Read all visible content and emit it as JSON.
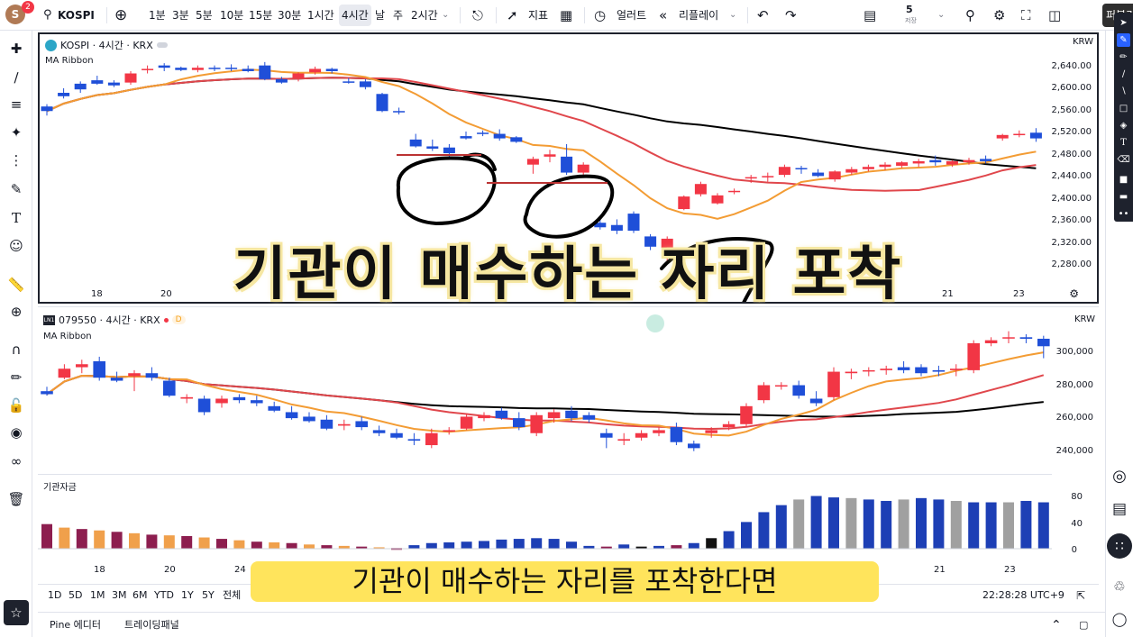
{
  "top_toolbar": {
    "avatar_initial": "S",
    "notification_count": "2",
    "symbol": "KOSPI",
    "intervals": [
      "1분",
      "3분",
      "5분",
      "10분",
      "15분",
      "30분",
      "1시간",
      "4시간",
      "날",
      "주",
      "2시간"
    ],
    "active_interval": "4시간",
    "indicators_label": "지표",
    "alert_label": "얼러트",
    "replay_label": "리플레이",
    "layout_number": "5",
    "layout_sub": "저장",
    "publish_label": "퍼블리"
  },
  "chart1": {
    "legend_title": "KOSPI · 4시간 · KRX",
    "indicator": "MA Ribbon",
    "currency": "KRW",
    "price_labels": [
      "2,640.00",
      "2,600.00",
      "2,560.00",
      "2,520.00",
      "2,480.00",
      "2,440.00",
      "2,400.00",
      "2,360.00",
      "2,320.00",
      "2,280.00"
    ],
    "date_labels": [
      "18",
      "20",
      "21",
      "23"
    ]
  },
  "chart2": {
    "legend_title": "079550 · 4시간 · KRX",
    "legend_badge": "D",
    "indicator": "MA Ribbon",
    "currency": "KRW",
    "price_labels": [
      "300,000",
      "280,000",
      "260,000",
      "240,000"
    ],
    "sub_indicator": "기관자금",
    "sub_labels": [
      "80",
      "40",
      "0"
    ],
    "date_labels": [
      "18",
      "20",
      "24",
      "21",
      "23"
    ]
  },
  "bottom_bar": {
    "ranges": [
      "1D",
      "5D",
      "1M",
      "3M",
      "6M",
      "YTD",
      "1Y",
      "5Y",
      "전체"
    ],
    "clock": "22:28:28 UTC+9"
  },
  "footer": {
    "tabs": [
      "Pine 에디터",
      "트레이딩패널"
    ]
  },
  "captions": {
    "headline": "기관이 매수하는 자리 포착",
    "subtitle": "기관이 매수하는 자리를 포착한다면"
  },
  "colors": {
    "up": "#f23645",
    "down": "#1f4fd8",
    "ma_fast": "#f39c34",
    "ma_mid": "#e0474c",
    "ma_slow": "#000000",
    "caption_bg": "#ffe45c"
  },
  "chart_data": [
    {
      "type": "candlestick",
      "title": "KOSPI · 4시간 · KRX",
      "indicator": "MA Ribbon",
      "ylim": [
        2260,
        2660
      ],
      "candles": [
        [
          2568,
          2572,
          2552,
          2560
        ],
        [
          2592,
          2600,
          2582,
          2586
        ],
        [
          2608,
          2612,
          2592,
          2598
        ],
        [
          2614,
          2622,
          2606,
          2608
        ],
        [
          2610,
          2614,
          2602,
          2605
        ],
        [
          2610,
          2630,
          2606,
          2626
        ],
        [
          2632,
          2640,
          2626,
          2634
        ],
        [
          2640,
          2644,
          2630,
          2636
        ],
        [
          2636,
          2638,
          2630,
          2632
        ],
        [
          2632,
          2640,
          2628,
          2636
        ],
        [
          2636,
          2640,
          2630,
          2634
        ],
        [
          2636,
          2642,
          2630,
          2634
        ],
        [
          2634,
          2640,
          2628,
          2630
        ],
        [
          2640,
          2646,
          2614,
          2616
        ],
        [
          2616,
          2620,
          2608,
          2610
        ],
        [
          2618,
          2628,
          2612,
          2626
        ],
        [
          2628,
          2638,
          2624,
          2634
        ],
        [
          2634,
          2636,
          2626,
          2630
        ],
        [
          2612,
          2618,
          2608,
          2610
        ],
        [
          2612,
          2616,
          2598,
          2602
        ],
        [
          2590,
          2592,
          2558,
          2560
        ],
        [
          2560,
          2566,
          2554,
          2558
        ],
        [
          2510,
          2520,
          2496,
          2498
        ],
        [
          2498,
          2510,
          2490,
          2494
        ],
        [
          2496,
          2502,
          2480,
          2486
        ],
        [
          2516,
          2524,
          2510,
          2512
        ],
        [
          2522,
          2526,
          2516,
          2520
        ],
        [
          2520,
          2528,
          2508,
          2512
        ],
        [
          2514,
          2516,
          2504,
          2506
        ],
        [
          2466,
          2480,
          2450,
          2476
        ],
        [
          2480,
          2492,
          2470,
          2484
        ],
        [
          2480,
          2502,
          2448,
          2452
        ],
        [
          2452,
          2470,
          2448,
          2466
        ],
        [
          2364,
          2376,
          2352,
          2356
        ],
        [
          2360,
          2370,
          2344,
          2350
        ],
        [
          2380,
          2384,
          2346,
          2350
        ],
        [
          2340,
          2344,
          2316,
          2322
        ],
        [
          2320,
          2340,
          2296,
          2336
        ],
        [
          2388,
          2412,
          2386,
          2410
        ],
        [
          2414,
          2436,
          2410,
          2432
        ],
        [
          2398,
          2416,
          2396,
          2412
        ],
        [
          2418,
          2424,
          2414,
          2420
        ],
        [
          2442,
          2448,
          2434,
          2444
        ],
        [
          2444,
          2452,
          2436,
          2446
        ],
        [
          2448,
          2466,
          2444,
          2462
        ],
        [
          2460,
          2464,
          2450,
          2458
        ],
        [
          2452,
          2458,
          2444,
          2446
        ],
        [
          2440,
          2456,
          2436,
          2454
        ],
        [
          2452,
          2462,
          2448,
          2458
        ],
        [
          2458,
          2466,
          2454,
          2462
        ],
        [
          2462,
          2470,
          2456,
          2466
        ],
        [
          2464,
          2472,
          2460,
          2470
        ],
        [
          2468,
          2476,
          2462,
          2472
        ],
        [
          2474,
          2482,
          2464,
          2470
        ],
        [
          2466,
          2474,
          2462,
          2472
        ],
        [
          2470,
          2478,
          2466,
          2474
        ],
        [
          2476,
          2482,
          2468,
          2472
        ],
        [
          2512,
          2520,
          2508,
          2518
        ],
        [
          2518,
          2526,
          2514,
          2520
        ],
        [
          2522,
          2530,
          2506,
          2512
        ]
      ]
    },
    {
      "type": "candlestick",
      "title": "079550 · 4시간 · KRX",
      "indicator": "MA Ribbon",
      "ylim": [
        225000,
        320000
      ],
      "candles": [
        [
          276000,
          279000,
          273000,
          274000
        ],
        [
          285000,
          294000,
          284000,
          291000
        ],
        [
          292000,
          297000,
          288000,
          294000
        ],
        [
          296000,
          299000,
          283000,
          285000
        ],
        [
          285000,
          289000,
          282000,
          283000
        ],
        [
          286000,
          290000,
          276000,
          288000
        ],
        [
          288000,
          292000,
          283000,
          285000
        ],
        [
          283000,
          285000,
          272000,
          273000
        ],
        [
          271000,
          274000,
          268000,
          272000
        ],
        [
          271000,
          273000,
          260000,
          262000
        ],
        [
          268000,
          273000,
          265000,
          271000
        ],
        [
          272000,
          274000,
          268000,
          270000
        ],
        [
          270000,
          273000,
          266000,
          268000
        ],
        [
          266000,
          269000,
          262000,
          263000
        ],
        [
          262000,
          266000,
          257000,
          258000
        ],
        [
          259000,
          262000,
          255000,
          256000
        ],
        [
          257000,
          260000,
          250000,
          251000
        ],
        [
          253000,
          257000,
          250000,
          254000
        ],
        [
          256000,
          259000,
          250000,
          252000
        ],
        [
          250000,
          253000,
          246000,
          248000
        ],
        [
          248000,
          251000,
          244000,
          245000
        ],
        [
          244000,
          248000,
          240000,
          243000
        ],
        [
          240000,
          251000,
          238000,
          248000
        ],
        [
          249000,
          252000,
          247000,
          250000
        ],
        [
          251000,
          261000,
          250000,
          259000
        ],
        [
          258000,
          262000,
          256000,
          260000
        ],
        [
          263000,
          265000,
          257000,
          258000
        ],
        [
          258000,
          262000,
          250000,
          252000
        ],
        [
          248000,
          262000,
          246000,
          260000
        ],
        [
          258000,
          264000,
          255000,
          262000
        ],
        [
          263000,
          266000,
          256000,
          258000
        ],
        [
          260000,
          262000,
          255000,
          257000
        ],
        [
          248000,
          251000,
          238000,
          245000
        ],
        [
          243000,
          248000,
          240000,
          244000
        ],
        [
          245000,
          250000,
          243000,
          248000
        ],
        [
          248000,
          252000,
          246000,
          250000
        ],
        [
          252000,
          255000,
          240000,
          242000
        ],
        [
          241000,
          243000,
          236000,
          238000
        ],
        [
          248000,
          252000,
          245000,
          250000
        ],
        [
          252000,
          256000,
          250000,
          254000
        ],
        [
          254000,
          268000,
          252000,
          266000
        ],
        [
          270000,
          282000,
          268000,
          280000
        ],
        [
          280000,
          282000,
          277000,
          280000
        ],
        [
          280000,
          283000,
          271000,
          273000
        ],
        [
          271000,
          276000,
          266000,
          268000
        ],
        [
          272000,
          292000,
          270000,
          289000
        ],
        [
          288000,
          291000,
          284000,
          289000
        ],
        [
          290000,
          292000,
          286000,
          290000
        ],
        [
          290000,
          293000,
          287000,
          291000
        ],
        [
          292000,
          296000,
          288000,
          290000
        ],
        [
          292000,
          294000,
          286000,
          288000
        ],
        [
          290000,
          293000,
          286000,
          289000
        ],
        [
          290000,
          294000,
          286000,
          291000
        ],
        [
          290000,
          310000,
          288000,
          308000
        ],
        [
          308000,
          312000,
          306000,
          310000
        ],
        [
          312000,
          316000,
          308000,
          312000
        ],
        [
          312000,
          314000,
          308000,
          311000
        ],
        [
          311000,
          313000,
          298000,
          306000
        ]
      ]
    },
    {
      "type": "bar",
      "title": "기관자금",
      "ylim": [
        0,
        100
      ],
      "values": [
        -35,
        -30,
        -28,
        -26,
        -24,
        -22,
        -20,
        -19,
        -18,
        -16,
        -14,
        -12,
        -10,
        -9,
        -8,
        -6,
        -5,
        -4,
        -3,
        -2,
        -1,
        5,
        8,
        9,
        10,
        11,
        13,
        14,
        15,
        14,
        10,
        4,
        -3,
        6,
        3,
        4,
        -5,
        8,
        15,
        25,
        38,
        52,
        62,
        70,
        75,
        73,
        72,
        70,
        68,
        70,
        72,
        70,
        68,
        66,
        66,
        66,
        68,
        66,
        64,
        62
      ]
    }
  ]
}
